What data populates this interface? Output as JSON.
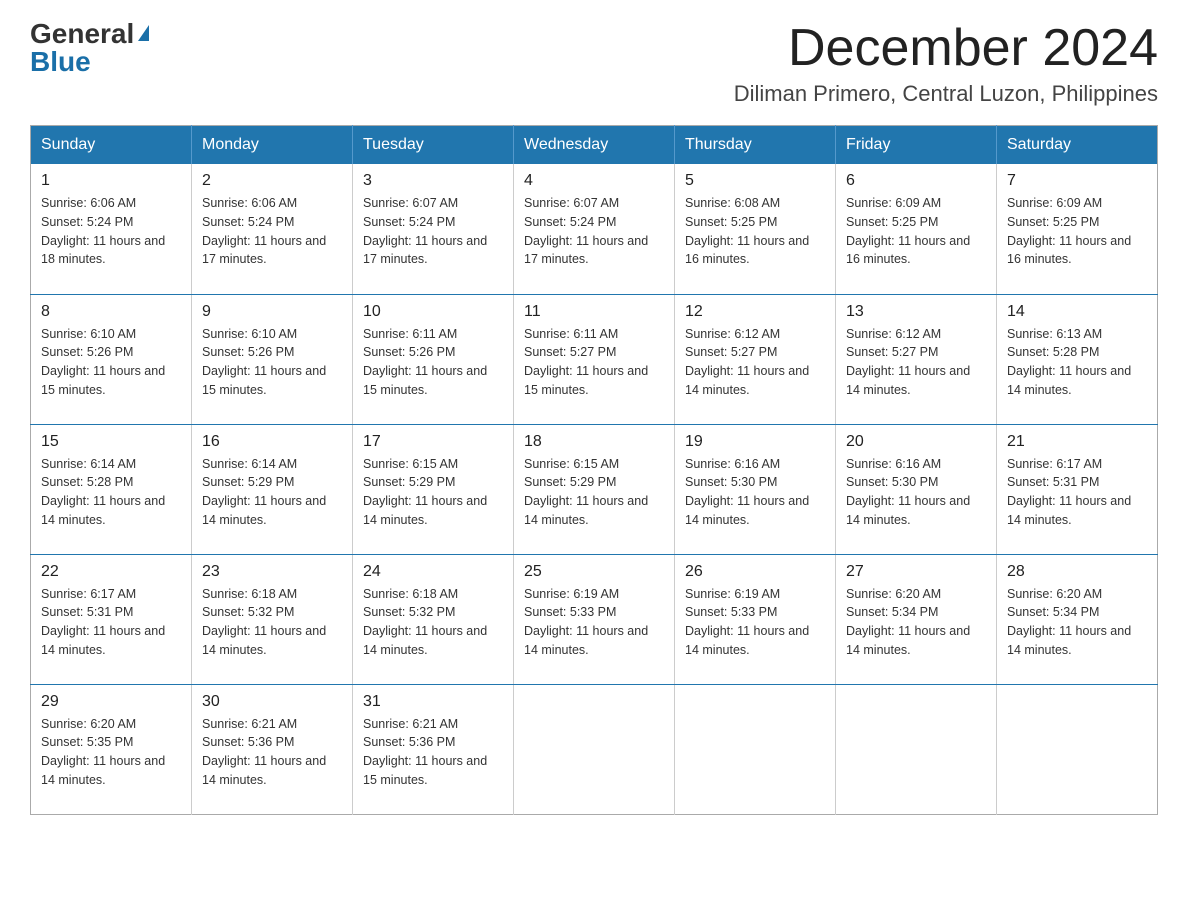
{
  "header": {
    "logo_general": "General",
    "logo_blue": "Blue",
    "month_title": "December 2024",
    "location": "Diliman Primero, Central Luzon, Philippines"
  },
  "weekdays": [
    "Sunday",
    "Monday",
    "Tuesday",
    "Wednesday",
    "Thursday",
    "Friday",
    "Saturday"
  ],
  "weeks": [
    [
      {
        "day": "1",
        "sunrise": "6:06 AM",
        "sunset": "5:24 PM",
        "daylight": "11 hours and 18 minutes."
      },
      {
        "day": "2",
        "sunrise": "6:06 AM",
        "sunset": "5:24 PM",
        "daylight": "11 hours and 17 minutes."
      },
      {
        "day": "3",
        "sunrise": "6:07 AM",
        "sunset": "5:24 PM",
        "daylight": "11 hours and 17 minutes."
      },
      {
        "day": "4",
        "sunrise": "6:07 AM",
        "sunset": "5:24 PM",
        "daylight": "11 hours and 17 minutes."
      },
      {
        "day": "5",
        "sunrise": "6:08 AM",
        "sunset": "5:25 PM",
        "daylight": "11 hours and 16 minutes."
      },
      {
        "day": "6",
        "sunrise": "6:09 AM",
        "sunset": "5:25 PM",
        "daylight": "11 hours and 16 minutes."
      },
      {
        "day": "7",
        "sunrise": "6:09 AM",
        "sunset": "5:25 PM",
        "daylight": "11 hours and 16 minutes."
      }
    ],
    [
      {
        "day": "8",
        "sunrise": "6:10 AM",
        "sunset": "5:26 PM",
        "daylight": "11 hours and 15 minutes."
      },
      {
        "day": "9",
        "sunrise": "6:10 AM",
        "sunset": "5:26 PM",
        "daylight": "11 hours and 15 minutes."
      },
      {
        "day": "10",
        "sunrise": "6:11 AM",
        "sunset": "5:26 PM",
        "daylight": "11 hours and 15 minutes."
      },
      {
        "day": "11",
        "sunrise": "6:11 AM",
        "sunset": "5:27 PM",
        "daylight": "11 hours and 15 minutes."
      },
      {
        "day": "12",
        "sunrise": "6:12 AM",
        "sunset": "5:27 PM",
        "daylight": "11 hours and 14 minutes."
      },
      {
        "day": "13",
        "sunrise": "6:12 AM",
        "sunset": "5:27 PM",
        "daylight": "11 hours and 14 minutes."
      },
      {
        "day": "14",
        "sunrise": "6:13 AM",
        "sunset": "5:28 PM",
        "daylight": "11 hours and 14 minutes."
      }
    ],
    [
      {
        "day": "15",
        "sunrise": "6:14 AM",
        "sunset": "5:28 PM",
        "daylight": "11 hours and 14 minutes."
      },
      {
        "day": "16",
        "sunrise": "6:14 AM",
        "sunset": "5:29 PM",
        "daylight": "11 hours and 14 minutes."
      },
      {
        "day": "17",
        "sunrise": "6:15 AM",
        "sunset": "5:29 PM",
        "daylight": "11 hours and 14 minutes."
      },
      {
        "day": "18",
        "sunrise": "6:15 AM",
        "sunset": "5:29 PM",
        "daylight": "11 hours and 14 minutes."
      },
      {
        "day": "19",
        "sunrise": "6:16 AM",
        "sunset": "5:30 PM",
        "daylight": "11 hours and 14 minutes."
      },
      {
        "day": "20",
        "sunrise": "6:16 AM",
        "sunset": "5:30 PM",
        "daylight": "11 hours and 14 minutes."
      },
      {
        "day": "21",
        "sunrise": "6:17 AM",
        "sunset": "5:31 PM",
        "daylight": "11 hours and 14 minutes."
      }
    ],
    [
      {
        "day": "22",
        "sunrise": "6:17 AM",
        "sunset": "5:31 PM",
        "daylight": "11 hours and 14 minutes."
      },
      {
        "day": "23",
        "sunrise": "6:18 AM",
        "sunset": "5:32 PM",
        "daylight": "11 hours and 14 minutes."
      },
      {
        "day": "24",
        "sunrise": "6:18 AM",
        "sunset": "5:32 PM",
        "daylight": "11 hours and 14 minutes."
      },
      {
        "day": "25",
        "sunrise": "6:19 AM",
        "sunset": "5:33 PM",
        "daylight": "11 hours and 14 minutes."
      },
      {
        "day": "26",
        "sunrise": "6:19 AM",
        "sunset": "5:33 PM",
        "daylight": "11 hours and 14 minutes."
      },
      {
        "day": "27",
        "sunrise": "6:20 AM",
        "sunset": "5:34 PM",
        "daylight": "11 hours and 14 minutes."
      },
      {
        "day": "28",
        "sunrise": "6:20 AM",
        "sunset": "5:34 PM",
        "daylight": "11 hours and 14 minutes."
      }
    ],
    [
      {
        "day": "29",
        "sunrise": "6:20 AM",
        "sunset": "5:35 PM",
        "daylight": "11 hours and 14 minutes."
      },
      {
        "day": "30",
        "sunrise": "6:21 AM",
        "sunset": "5:36 PM",
        "daylight": "11 hours and 14 minutes."
      },
      {
        "day": "31",
        "sunrise": "6:21 AM",
        "sunset": "5:36 PM",
        "daylight": "11 hours and 15 minutes."
      },
      null,
      null,
      null,
      null
    ]
  ],
  "labels": {
    "sunrise_prefix": "Sunrise: ",
    "sunset_prefix": "Sunset: ",
    "daylight_prefix": "Daylight: "
  }
}
